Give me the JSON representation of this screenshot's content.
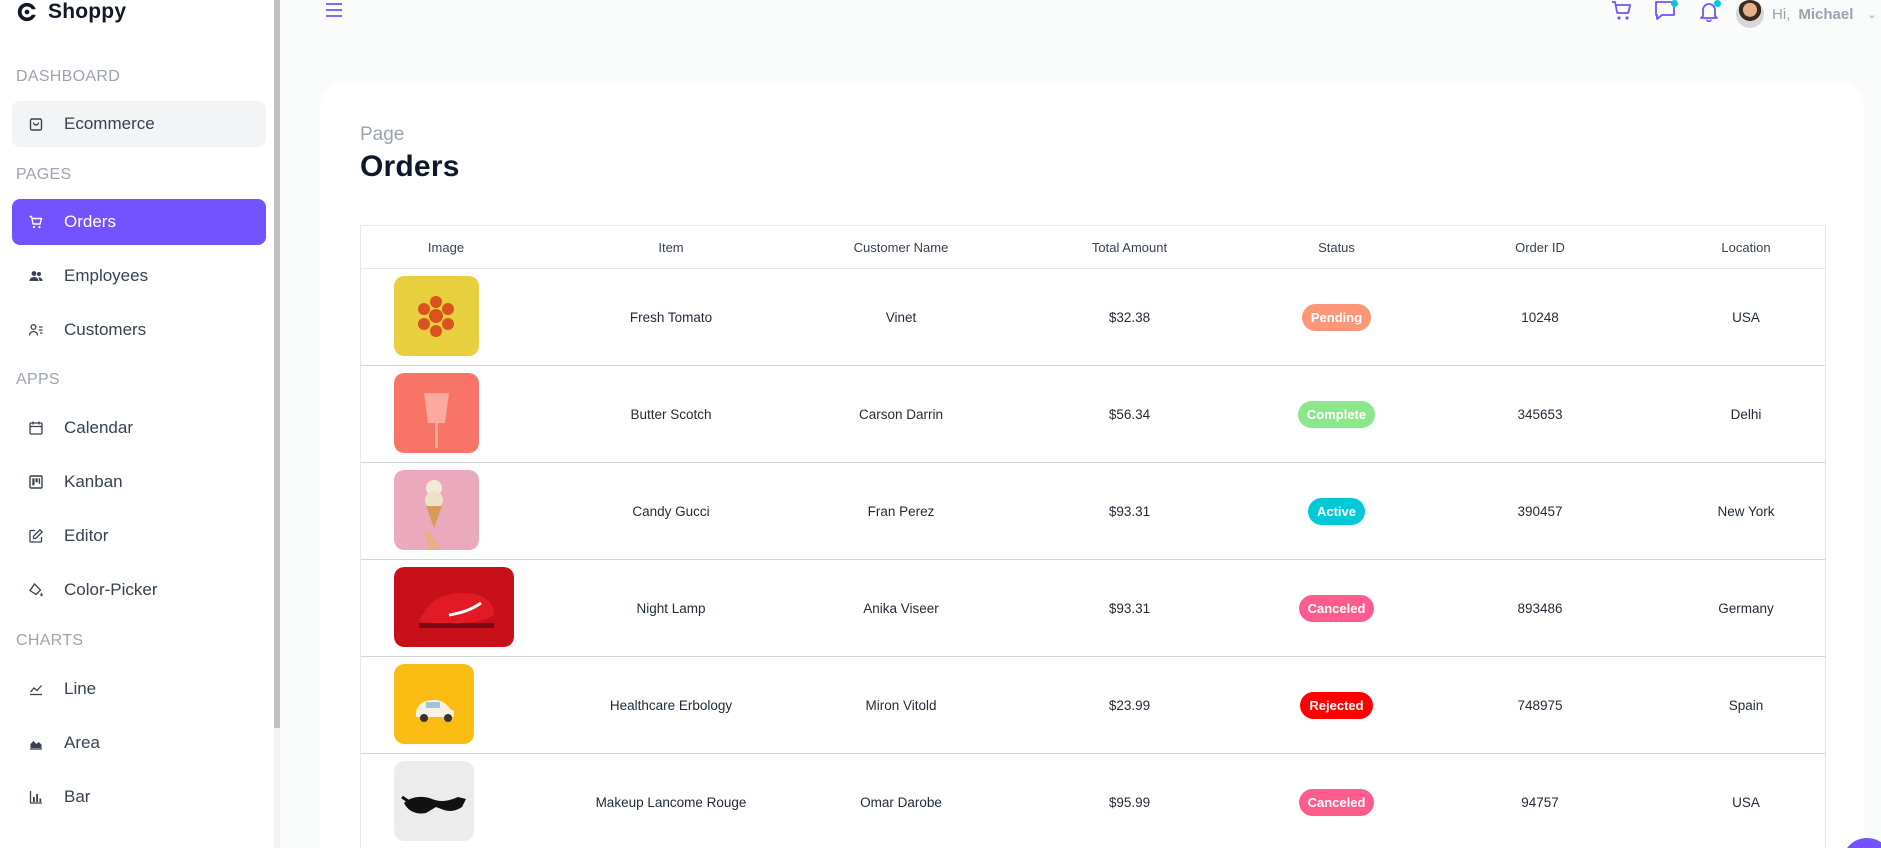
{
  "app": {
    "name": "Shoppy"
  },
  "sidebar": {
    "sections": [
      {
        "title": "DASHBOARD"
      },
      {
        "title": "PAGES"
      },
      {
        "title": "APPS"
      },
      {
        "title": "CHARTS"
      }
    ],
    "items": [
      {
        "label": "Ecommerce",
        "icon": "shopping-bag-icon"
      },
      {
        "label": "Orders",
        "icon": "cart-icon",
        "active": true
      },
      {
        "label": "Employees",
        "icon": "users-icon"
      },
      {
        "label": "Customers",
        "icon": "user-list-icon"
      },
      {
        "label": "Calendar",
        "icon": "calendar-icon"
      },
      {
        "label": "Kanban",
        "icon": "kanban-icon"
      },
      {
        "label": "Editor",
        "icon": "edit-icon"
      },
      {
        "label": "Color-Picker",
        "icon": "paint-bucket-icon"
      },
      {
        "label": "Line",
        "icon": "line-chart-icon"
      },
      {
        "label": "Area",
        "icon": "area-chart-icon"
      },
      {
        "label": "Bar",
        "icon": "bar-chart-icon"
      }
    ]
  },
  "header": {
    "greeting": "Hi,",
    "username": "Michael",
    "icons": [
      "menu-icon",
      "cart-icon",
      "chat-icon",
      "bell-icon"
    ]
  },
  "page": {
    "subtitle": "Page",
    "title": "Orders"
  },
  "table": {
    "columns": [
      "Image",
      "Item",
      "Customer Name",
      "Total Amount",
      "Status",
      "Order ID",
      "Location"
    ],
    "rows": [
      {
        "item": "Fresh Tomato",
        "customer": "Vinet",
        "amount": "$32.38",
        "status": "Pending",
        "status_color": "#fb9678",
        "order_id": "10248",
        "location": "USA"
      },
      {
        "item": "Butter Scotch",
        "customer": "Carson Darrin",
        "amount": "$56.34",
        "status": "Complete",
        "status_color": "#8be78b",
        "order_id": "345653",
        "location": "Delhi"
      },
      {
        "item": "Candy Gucci",
        "customer": "Fran Perez",
        "amount": "$93.31",
        "status": "Active",
        "status_color": "#03c9d7",
        "order_id": "390457",
        "location": "New York"
      },
      {
        "item": "Night Lamp",
        "customer": "Anika Viseer",
        "amount": "$93.31",
        "status": "Canceled",
        "status_color": "#ff5c8e",
        "order_id": "893486",
        "location": "Germany"
      },
      {
        "item": "Healthcare Erbology",
        "customer": "Miron Vitold",
        "amount": "$23.99",
        "status": "Rejected",
        "status_color": "#ff0000",
        "order_id": "748975",
        "location": "Spain"
      },
      {
        "item": "Makeup Lancome Rouge",
        "customer": "Omar Darobe",
        "amount": "$95.99",
        "status": "Canceled",
        "status_color": "#ff5c8e",
        "order_id": "94757",
        "location": "USA"
      }
    ]
  },
  "colors": {
    "accent": "#7352ff"
  }
}
